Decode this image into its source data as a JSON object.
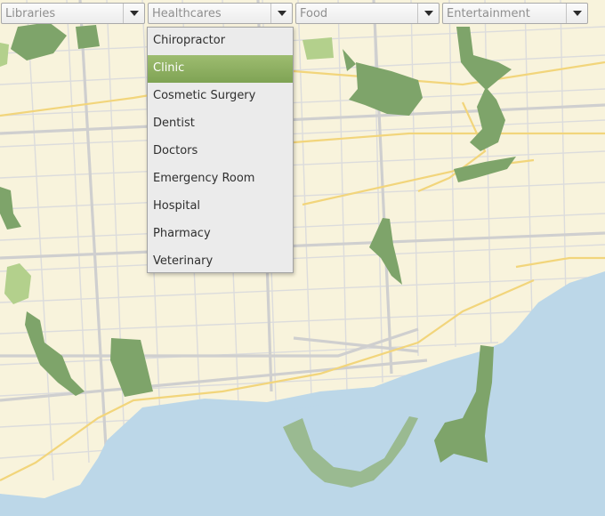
{
  "filters": [
    {
      "placeholder": "Libraries"
    },
    {
      "placeholder": "Healthcares"
    },
    {
      "placeholder": "Food"
    },
    {
      "placeholder": "Entertainment"
    }
  ],
  "dropdown": {
    "options": [
      "Chiropractor",
      "Clinic",
      "Cosmetic Surgery",
      "Dentist",
      "Doctors",
      "Emergency Room",
      "Hospital",
      "Pharmacy",
      "Veterinary"
    ],
    "highlighted": "Clinic"
  },
  "colors": {
    "land": "#f8f3dc",
    "water": "#bcd7e8",
    "park": "#7ea46a",
    "light_park": "#b3d08c",
    "road": "#d2d2d2",
    "major_road": "#f6dc85",
    "highlight": "#8fb162"
  }
}
